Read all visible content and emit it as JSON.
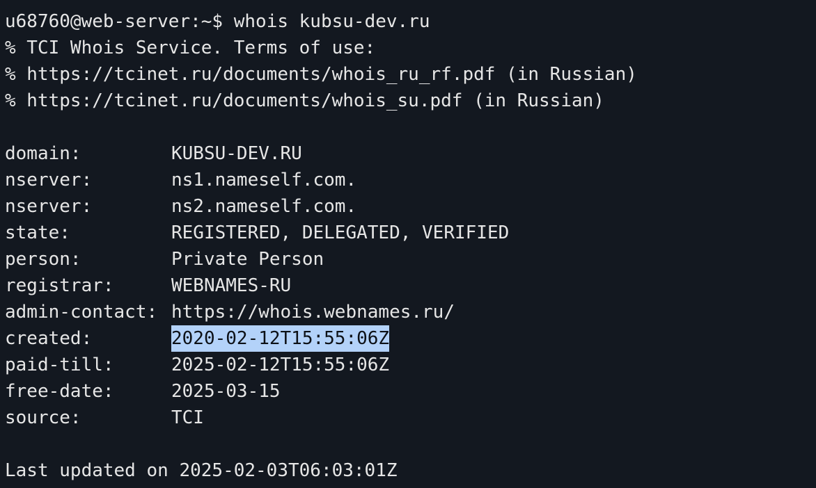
{
  "prompt": {
    "user_host": "u68760@web-server:~$",
    "command": "whois kubsu-dev.ru"
  },
  "header_lines": [
    "% TCI Whois Service. Terms of use:",
    "% https://tcinet.ru/documents/whois_ru_rf.pdf (in Russian)",
    "% https://tcinet.ru/documents/whois_su.pdf (in Russian)"
  ],
  "records": [
    {
      "key": "domain:",
      "value": "KUBSU-DEV.RU"
    },
    {
      "key": "nserver:",
      "value": "ns1.nameself.com."
    },
    {
      "key": "nserver:",
      "value": "ns2.nameself.com."
    },
    {
      "key": "state:",
      "value": "REGISTERED, DELEGATED, VERIFIED"
    },
    {
      "key": "person:",
      "value": "Private Person"
    },
    {
      "key": "registrar:",
      "value": "WEBNAMES-RU"
    },
    {
      "key": "admin-contact:",
      "value": "https://whois.webnames.ru/"
    },
    {
      "key": "created:",
      "value": "2020-02-12T15:55:06Z"
    },
    {
      "key": "paid-till:",
      "value": "2025-02-12T15:55:06Z"
    },
    {
      "key": "free-date:",
      "value": "2025-03-15"
    },
    {
      "key": "source:",
      "value": "TCI"
    }
  ],
  "footer": "Last updated on 2025-02-03T06:03:01Z",
  "colors": {
    "background": "#131820",
    "text": "#e6e6e6",
    "selection": "#b3d2f9"
  }
}
